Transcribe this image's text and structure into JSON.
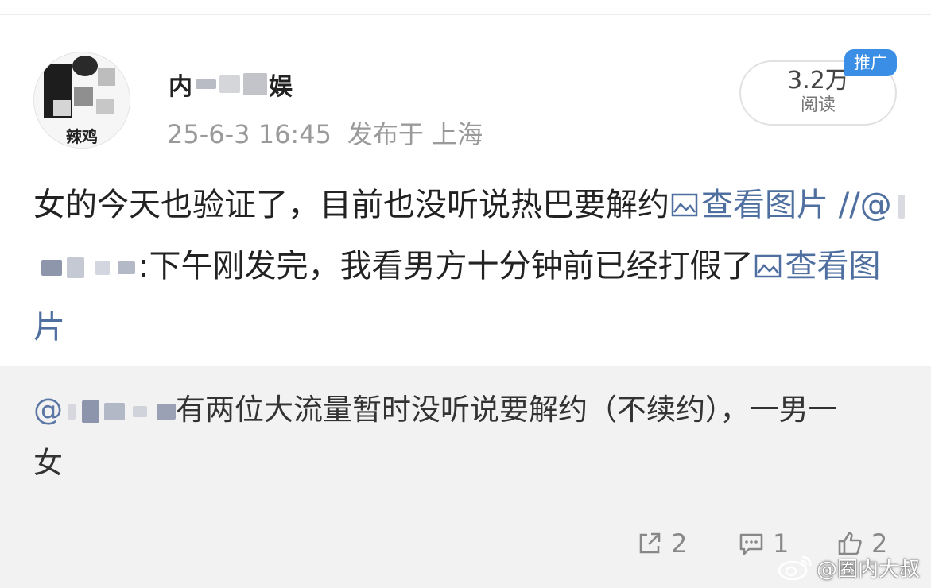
{
  "post": {
    "avatar_label": "辣鸡",
    "username_start": "内",
    "username_end": "娱",
    "timestamp": "25-6-3 16:45",
    "published_in": "发布于 上海",
    "read_count": "3.2万",
    "read_label": "阅读",
    "promo_tag": "推广",
    "line1": "女的今天也验证了，目前也没听说热巴要解约",
    "view_image_1": "查看图片",
    "repost_prefix": "//@",
    "repost_text": ":下午刚发完，我看男方十分钟前已经打假了",
    "view_image_2": "查看图片"
  },
  "quote": {
    "mention": "@",
    "text": "有两位大流量暂时没听说要解约（不续约），一男一女"
  },
  "actions": {
    "repost_count": "2",
    "comment_count": "1",
    "like_count": "2"
  },
  "watermark": {
    "text": "@圈内大叔"
  },
  "colors": {
    "link": "#4f6fa0",
    "promo": "#3a8ee6",
    "quote_bg": "#f2f2f2"
  }
}
